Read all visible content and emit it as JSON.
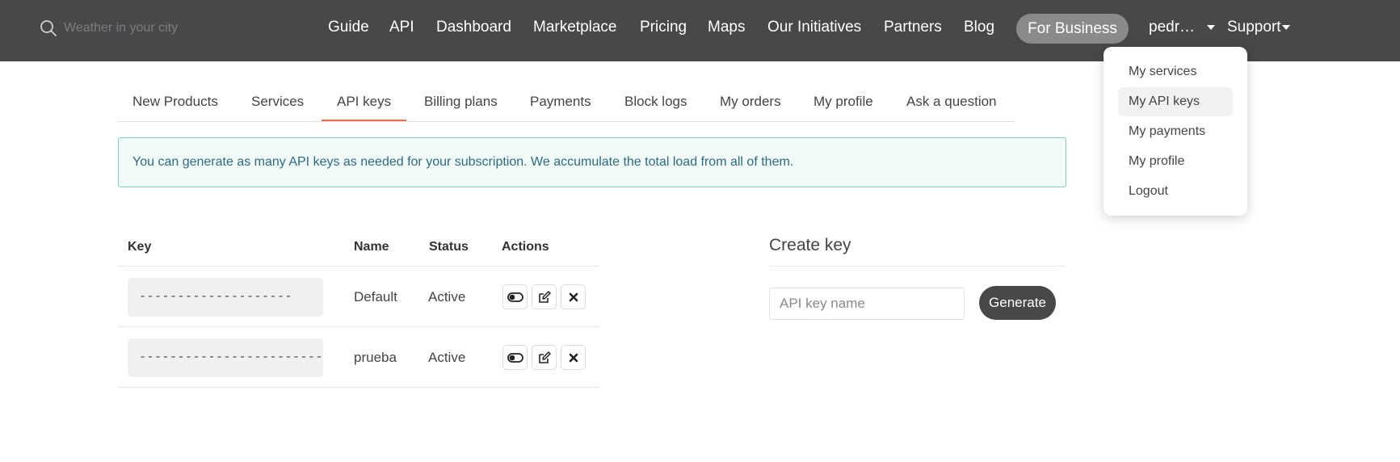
{
  "search": {
    "placeholder": "Weather in your city"
  },
  "nav": {
    "guide": "Guide",
    "api": "API",
    "dashboard": "Dashboard",
    "marketplace": "Marketplace",
    "pricing": "Pricing",
    "maps": "Maps",
    "initiatives": "Our Initiatives",
    "partners": "Partners",
    "blog": "Blog",
    "for_business": "For Business",
    "user": "pedr…",
    "support": "Support"
  },
  "user_menu": {
    "items": [
      "My services",
      "My API keys",
      "My payments",
      "My profile",
      "Logout"
    ],
    "active": "My API keys"
  },
  "tabs": {
    "items": [
      "New Products",
      "Services",
      "API keys",
      "Billing plans",
      "Payments",
      "Block logs",
      "My orders",
      "My profile",
      "Ask a question"
    ],
    "active": "API keys"
  },
  "alert": {
    "text": "You can generate as many API keys as needed for your subscription. We accumulate the total load from all of them."
  },
  "keys_table": {
    "headers": {
      "key": "Key",
      "name": "Name",
      "status": "Status",
      "actions": "Actions"
    },
    "rows": [
      {
        "key": "--------------------",
        "name": "Default",
        "status": "Active"
      },
      {
        "key": "-------------------------",
        "name": "prueba",
        "status": "Active"
      }
    ]
  },
  "create_key": {
    "title": "Create key",
    "input_placeholder": "API key name",
    "button": "Generate"
  },
  "icons": {
    "search": "search-icon",
    "toggle": "toggle-icon",
    "edit": "edit-icon",
    "delete": "close-icon"
  },
  "colors": {
    "topbar": "#48484a",
    "accent": "#e96e50",
    "alert_border": "#7fd1bb",
    "alert_text": "#2f6a83"
  }
}
